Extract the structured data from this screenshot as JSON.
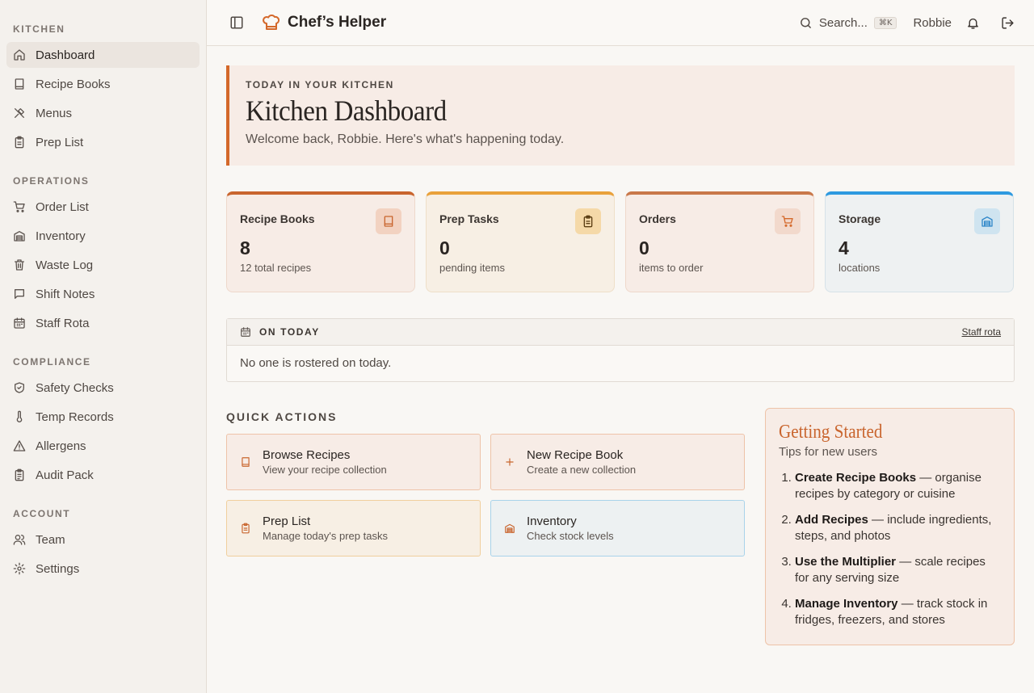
{
  "sidebar": {
    "sections": [
      {
        "heading": "KITCHEN",
        "items": [
          {
            "label": "Dashboard",
            "icon": "home-icon",
            "active": true
          },
          {
            "label": "Recipe Books",
            "icon": "book-icon"
          },
          {
            "label": "Menus",
            "icon": "utensils-icon"
          },
          {
            "label": "Prep List",
            "icon": "clipboard-icon"
          }
        ]
      },
      {
        "heading": "OPERATIONS",
        "items": [
          {
            "label": "Order List",
            "icon": "cart-icon"
          },
          {
            "label": "Inventory",
            "icon": "storage-icon"
          },
          {
            "label": "Waste Log",
            "icon": "trash-icon"
          },
          {
            "label": "Shift Notes",
            "icon": "message-icon"
          },
          {
            "label": "Staff Rota",
            "icon": "calendar-icon"
          }
        ]
      },
      {
        "heading": "COMPLIANCE",
        "items": [
          {
            "label": "Safety Checks",
            "icon": "shield-check-icon"
          },
          {
            "label": "Temp Records",
            "icon": "thermometer-icon"
          },
          {
            "label": "Allergens",
            "icon": "warning-icon"
          },
          {
            "label": "Audit Pack",
            "icon": "clipboard-list-icon"
          }
        ]
      },
      {
        "heading": "ACCOUNT",
        "items": [
          {
            "label": "Team",
            "icon": "users-icon"
          },
          {
            "label": "Settings",
            "icon": "gear-icon"
          }
        ]
      }
    ]
  },
  "header": {
    "app_title": "Chef’s Helper",
    "search_label": "Search...",
    "search_shortcut": "⌘K",
    "user_name": "Robbie"
  },
  "hero": {
    "eyebrow": "TODAY IN YOUR KITCHEN",
    "title": "Kitchen Dashboard",
    "welcome": "Welcome back, Robbie. Here's what's happening today."
  },
  "stats": [
    {
      "label": "Recipe Books",
      "value": "8",
      "sub": "12 total recipes",
      "icon": "book-icon",
      "accent": "#c9652e",
      "bg": "#f7ece6",
      "border": "#eed8cb",
      "badge_bg": "#f2d2c1",
      "badge_fg": "#c9652e"
    },
    {
      "label": "Prep Tasks",
      "value": "0",
      "sub": "pending items",
      "icon": "clipboard-icon",
      "accent": "#e9a13b",
      "bg": "#f7efe4",
      "border": "#eedfc8",
      "badge_bg": "#f5d9a8",
      "badge_fg": "#5a3d12"
    },
    {
      "label": "Orders",
      "value": "0",
      "sub": "items to order",
      "icon": "cart-icon",
      "accent": "#c9784a",
      "bg": "#f7ece6",
      "border": "#eed8cb",
      "badge_bg": "#f2d9cc",
      "badge_fg": "#d4682a"
    },
    {
      "label": "Storage",
      "value": "4",
      "sub": "locations",
      "icon": "storage-icon",
      "accent": "#2e9ae0",
      "bg": "#eef1f2",
      "border": "#d6e2e8",
      "badge_bg": "#cfe4f0",
      "badge_fg": "#2e86c9"
    }
  ],
  "on_today": {
    "title": "ON TODAY",
    "link": "Staff rota",
    "message": "No one is rostered on today."
  },
  "quick_actions": {
    "heading": "QUICK ACTIONS",
    "items": [
      {
        "title": "Browse Recipes",
        "subtitle": "View your recipe collection",
        "icon": "book-icon"
      },
      {
        "title": "New Recipe Book",
        "subtitle": "Create a new collection",
        "icon": "plus-icon"
      },
      {
        "title": "Prep List",
        "subtitle": "Manage today's prep tasks",
        "icon": "clipboard-icon"
      },
      {
        "title": "Inventory",
        "subtitle": "Check stock levels",
        "icon": "storage-icon"
      }
    ]
  },
  "getting_started": {
    "title": "Getting Started",
    "subtitle": "Tips for new users",
    "tips": [
      {
        "bold": "Create Recipe Books",
        "text": " — organise recipes by category or cuisine"
      },
      {
        "bold": "Add Recipes",
        "text": " — include ingredients, steps, and photos"
      },
      {
        "bold": "Use the Multiplier",
        "text": " — scale recipes for any serving size"
      },
      {
        "bold": "Manage Inventory",
        "text": " — track stock in fridges, freezers, and stores"
      }
    ]
  },
  "colors": {
    "accent": "#d4682a",
    "background": "#f9f7f4",
    "sidebar": "#f4f1ed"
  }
}
